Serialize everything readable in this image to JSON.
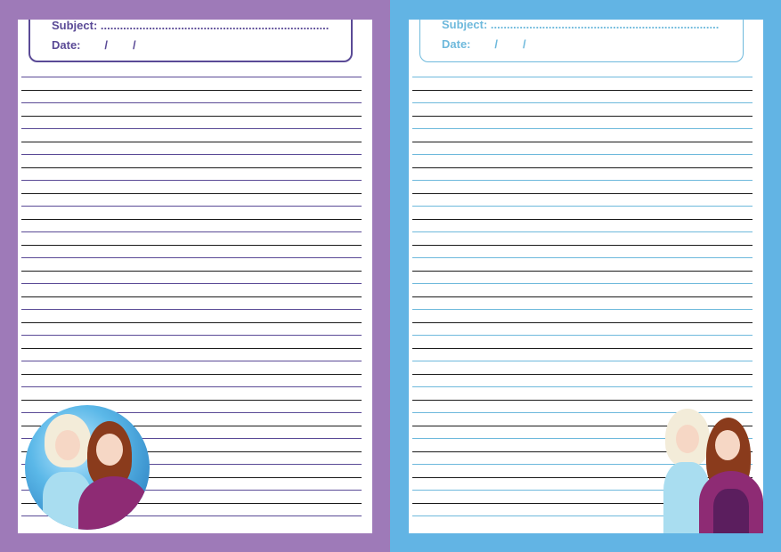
{
  "colors": {
    "left_background": "#9e7ab8",
    "left_accent": "#5a4a96",
    "right_background": "#62b4e4",
    "right_accent": "#6eb9dc",
    "rule_black": "#1a1a1a"
  },
  "left_page": {
    "subject_label": "Subject: .......................................................................",
    "date_label": "Date:",
    "date_sep_1": "/",
    "date_sep_2": "/",
    "decoration": "frozen-elsa-anna-circle"
  },
  "right_page": {
    "subject_label": "Subject: .......................................................................",
    "date_label": "Date:",
    "date_sep_1": "/",
    "date_sep_2": "/",
    "decoration": "frozen-elsa-anna-cutout"
  }
}
